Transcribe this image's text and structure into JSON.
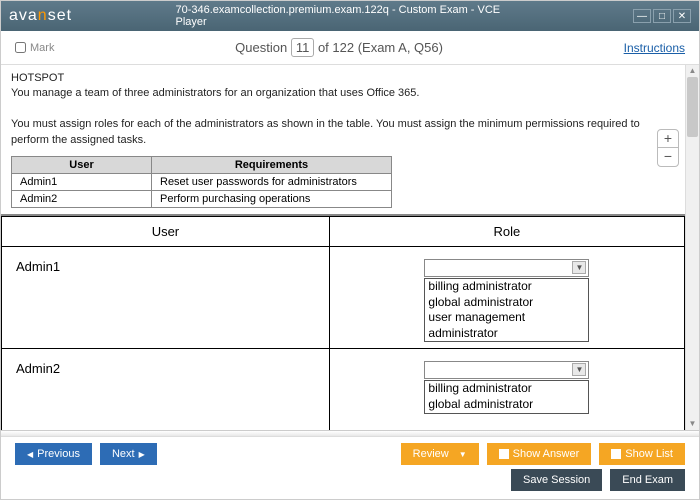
{
  "window": {
    "logo_pre": "ava",
    "logo_n": "n",
    "logo_post": "set",
    "title": "70-346.examcollection.premium.exam.122q - Custom Exam - VCE Player",
    "min": "—",
    "max": "□",
    "close": "✕"
  },
  "header": {
    "mark": "Mark",
    "q_pre": "Question",
    "q_num": "11",
    "q_post": " of 122 (Exam A, Q56)",
    "instructions": "Instructions"
  },
  "question": {
    "title": "HOTSPOT",
    "line1": "You manage a team of three administrators for an organization that uses Office 365.",
    "line2": "You must assign roles for each of the administrators as shown in the table. You must assign the minimum permissions required to perform the assigned tasks."
  },
  "req_table": {
    "h_user": "User",
    "h_req": "Requirements",
    "rows": [
      {
        "u": "Admin1",
        "r": "Reset user passwords for administrators"
      },
      {
        "u": "Admin2",
        "r": "Perform purchasing operations"
      }
    ]
  },
  "zoom": {
    "plus": "+",
    "minus": "−"
  },
  "hotspot": {
    "h_user": "User",
    "h_role": "Role",
    "r1_user": "Admin1",
    "r1_opts": [
      "billing administrator",
      "global administrator",
      "user management administrator"
    ],
    "r2_user": "Admin2",
    "r2_opts": [
      "billing administrator",
      "global administrator"
    ]
  },
  "footer": {
    "previous": "Previous",
    "next": "Next",
    "review": "Review",
    "show_answer": "Show Answer",
    "show_list": "Show List",
    "save_session": "Save Session",
    "end_exam": "End Exam"
  }
}
